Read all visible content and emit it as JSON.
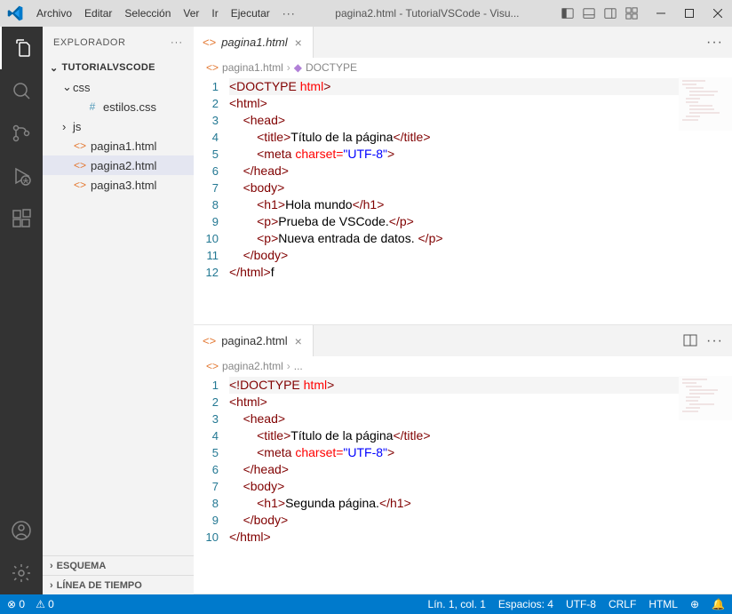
{
  "titlebar": {
    "menu": [
      "Archivo",
      "Editar",
      "Selección",
      "Ver",
      "Ir",
      "Ejecutar",
      "···"
    ],
    "title": "pagina2.html - TutorialVSCode - Visu..."
  },
  "sidebar": {
    "title": "EXPLORADOR",
    "project": "TUTORIALVSCODE",
    "tree": [
      {
        "indent": 1,
        "chev": "down",
        "icon": "",
        "label": "css",
        "type": "folder"
      },
      {
        "indent": 2,
        "chev": "",
        "icon": "#",
        "label": "estilos.css",
        "type": "css"
      },
      {
        "indent": 1,
        "chev": "right",
        "icon": "",
        "label": "js",
        "type": "folder"
      },
      {
        "indent": 1,
        "chev": "",
        "icon": "<>",
        "label": "pagina1.html",
        "type": "html"
      },
      {
        "indent": 1,
        "chev": "",
        "icon": "<>",
        "label": "pagina2.html",
        "type": "html",
        "selected": true
      },
      {
        "indent": 1,
        "chev": "",
        "icon": "<>",
        "label": "pagina3.html",
        "type": "html"
      }
    ],
    "sections": [
      "ESQUEMA",
      "LÍNEA DE TIEMPO"
    ]
  },
  "editor1": {
    "tab": "pagina1.html",
    "breadcrumb": [
      "pagina1.html",
      "DOCTYPE"
    ],
    "lines": [
      {
        "n": 1,
        "html": "<span class='tag'>&lt;DOCTYPE</span> <span class='attr'>html</span><span class='tag'>&gt;</span>",
        "hl": true
      },
      {
        "n": 2,
        "html": "<span class='tag'>&lt;html&gt;</span>"
      },
      {
        "n": 3,
        "html": "    <span class='tag'>&lt;head&gt;</span>"
      },
      {
        "n": 4,
        "html": "        <span class='tag'>&lt;title&gt;</span><span class='txt'>Título de la página</span><span class='tag'>&lt;/title&gt;</span>"
      },
      {
        "n": 5,
        "html": "        <span class='tag'>&lt;meta</span> <span class='attr'>charset=</span><span class='str'>\"UTF-8\"</span><span class='tag'>&gt;</span>"
      },
      {
        "n": 6,
        "html": "    <span class='tag'>&lt;/head&gt;</span>"
      },
      {
        "n": 7,
        "html": "    <span class='tag'>&lt;body&gt;</span>"
      },
      {
        "n": 8,
        "html": "        <span class='tag'>&lt;h1&gt;</span><span class='txt'>Hola mundo</span><span class='tag'>&lt;/h1&gt;</span>"
      },
      {
        "n": 9,
        "html": "        <span class='tag'>&lt;p&gt;</span><span class='txt'>Prueba de VSCode.</span><span class='tag'>&lt;/p&gt;</span>"
      },
      {
        "n": 10,
        "html": "        <span class='tag'>&lt;p&gt;</span><span class='txt'>Nueva entrada de datos. </span><span class='tag'>&lt;/p&gt;</span>"
      },
      {
        "n": 11,
        "html": "    <span class='tag'>&lt;/body&gt;</span>"
      },
      {
        "n": 12,
        "html": "<span class='tag'>&lt;/html&gt;</span><span class='txt'>f</span>"
      }
    ]
  },
  "editor2": {
    "tab": "pagina2.html",
    "breadcrumb": [
      "pagina2.html",
      "..."
    ],
    "lines": [
      {
        "n": 1,
        "html": "<span class='tag'>&lt;!DOCTYPE</span> <span class='attr'>html</span><span class='tag'>&gt;</span>",
        "hl": true
      },
      {
        "n": 2,
        "html": "<span class='tag'>&lt;html&gt;</span>"
      },
      {
        "n": 3,
        "html": "    <span class='tag'>&lt;head&gt;</span>"
      },
      {
        "n": 4,
        "html": "        <span class='tag'>&lt;title&gt;</span><span class='txt'>Título de la página</span><span class='tag'>&lt;/title&gt;</span>"
      },
      {
        "n": 5,
        "html": "        <span class='tag'>&lt;meta</span> <span class='attr'>charset=</span><span class='str'>\"UTF-8\"</span><span class='tag'>&gt;</span>"
      },
      {
        "n": 6,
        "html": "    <span class='tag'>&lt;/head&gt;</span>"
      },
      {
        "n": 7,
        "html": "    <span class='tag'>&lt;body&gt;</span>"
      },
      {
        "n": 8,
        "html": "        <span class='tag'>&lt;h1&gt;</span><span class='txt'>Segunda página.</span><span class='tag'>&lt;/h1&gt;</span>"
      },
      {
        "n": 9,
        "html": "    <span class='tag'>&lt;/body&gt;</span>"
      },
      {
        "n": 10,
        "html": "<span class='tag'>&lt;/html&gt;</span>"
      }
    ]
  },
  "statusbar": {
    "errors": "0",
    "warnings": "0",
    "pos": "Lín. 1, col. 1",
    "spaces": "Espacios: 4",
    "enc": "UTF-8",
    "eol": "CRLF",
    "lang": "HTML"
  }
}
